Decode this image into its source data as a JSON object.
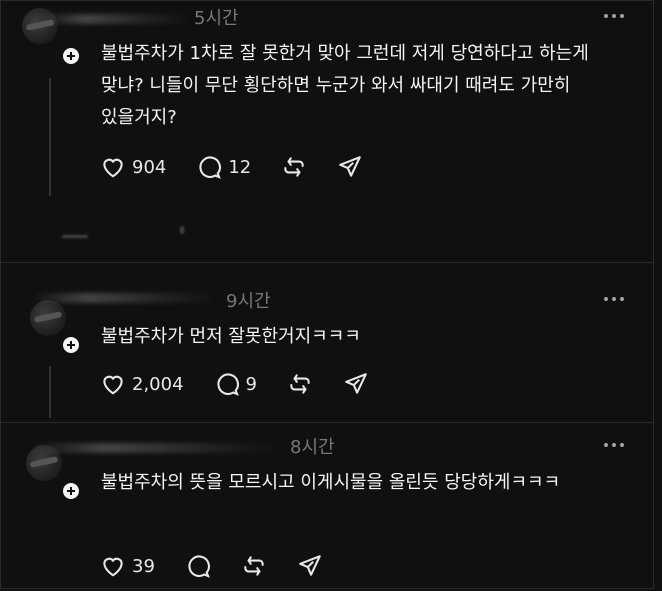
{
  "posts": [
    {
      "time": "5시간",
      "text": "불법주차가 1차로 잘 못한거 맞아 그런데 저게 당연하다고 하는게 맞냐? 니들이 무단 횡단하면 누군가 와서 싸대기 때려도 가만히 있을거지?",
      "likes": "904",
      "comments": "12"
    },
    {
      "time": "9시간",
      "text": "불법주차가 먼저 잘못한거지ㅋㅋㅋ",
      "likes": "2,004",
      "comments": "9"
    },
    {
      "time": "8시간",
      "text": "불법주차의 뜻을 모르시고 이게시물을 올린듯 당당하게ㅋㅋㅋ",
      "likes": "39",
      "comments": ""
    }
  ],
  "icons": [
    "heart-icon",
    "comment-icon",
    "repost-icon",
    "share-icon",
    "more-icon",
    "plus-badge-icon"
  ],
  "colors": {
    "background": "#101010",
    "text": "#f3f5f7",
    "muted": "#777777"
  }
}
